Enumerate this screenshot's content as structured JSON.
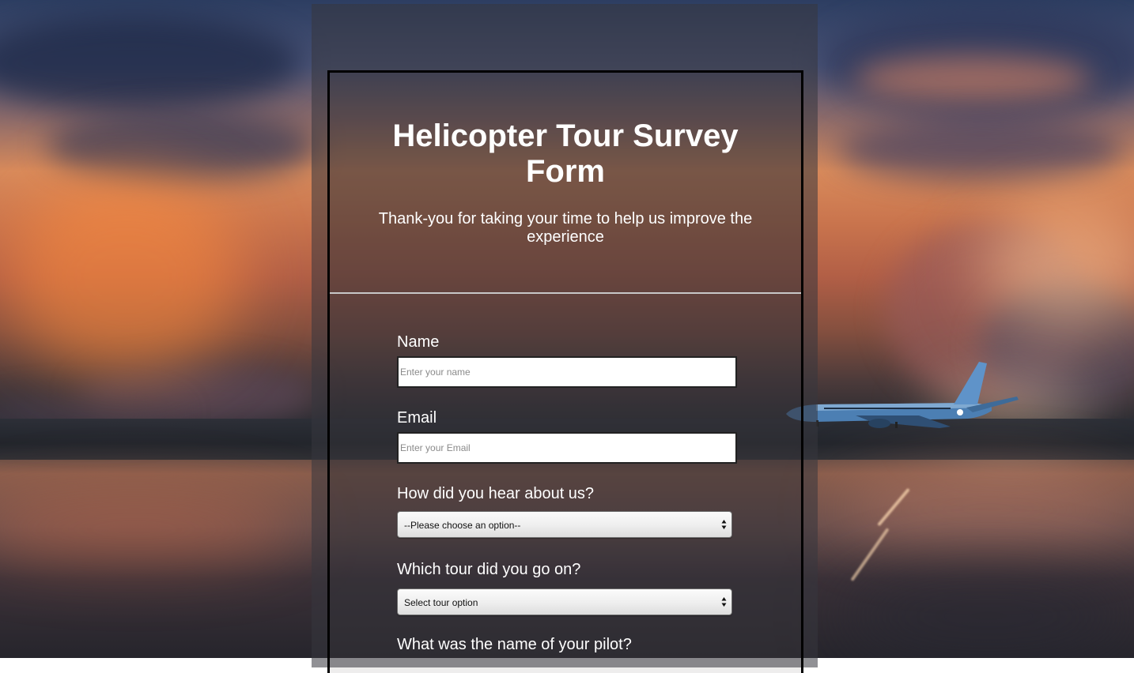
{
  "form": {
    "title": "Helicopter Tour Survey Form",
    "description": "Thank-you for taking your time to help us improve the experience",
    "name_label": "Name",
    "name_placeholder": "Enter your name",
    "email_label": "Email",
    "email_placeholder": "Enter your Email",
    "hear_label": "How did you hear about us?",
    "hear_selected": "--Please choose an option--",
    "tour_label": "Which tour did you go on?",
    "tour_selected": "Select tour option",
    "pilot_label": "What was the name of your pilot?"
  },
  "colors": {
    "text": "#ffffff",
    "panel": "rgba(55, 55, 62, 0.55)",
    "card_border": "#000000",
    "divider": "#c8c8c8",
    "input_background": "#ffffff",
    "placeholder": "#8a8a8a"
  }
}
